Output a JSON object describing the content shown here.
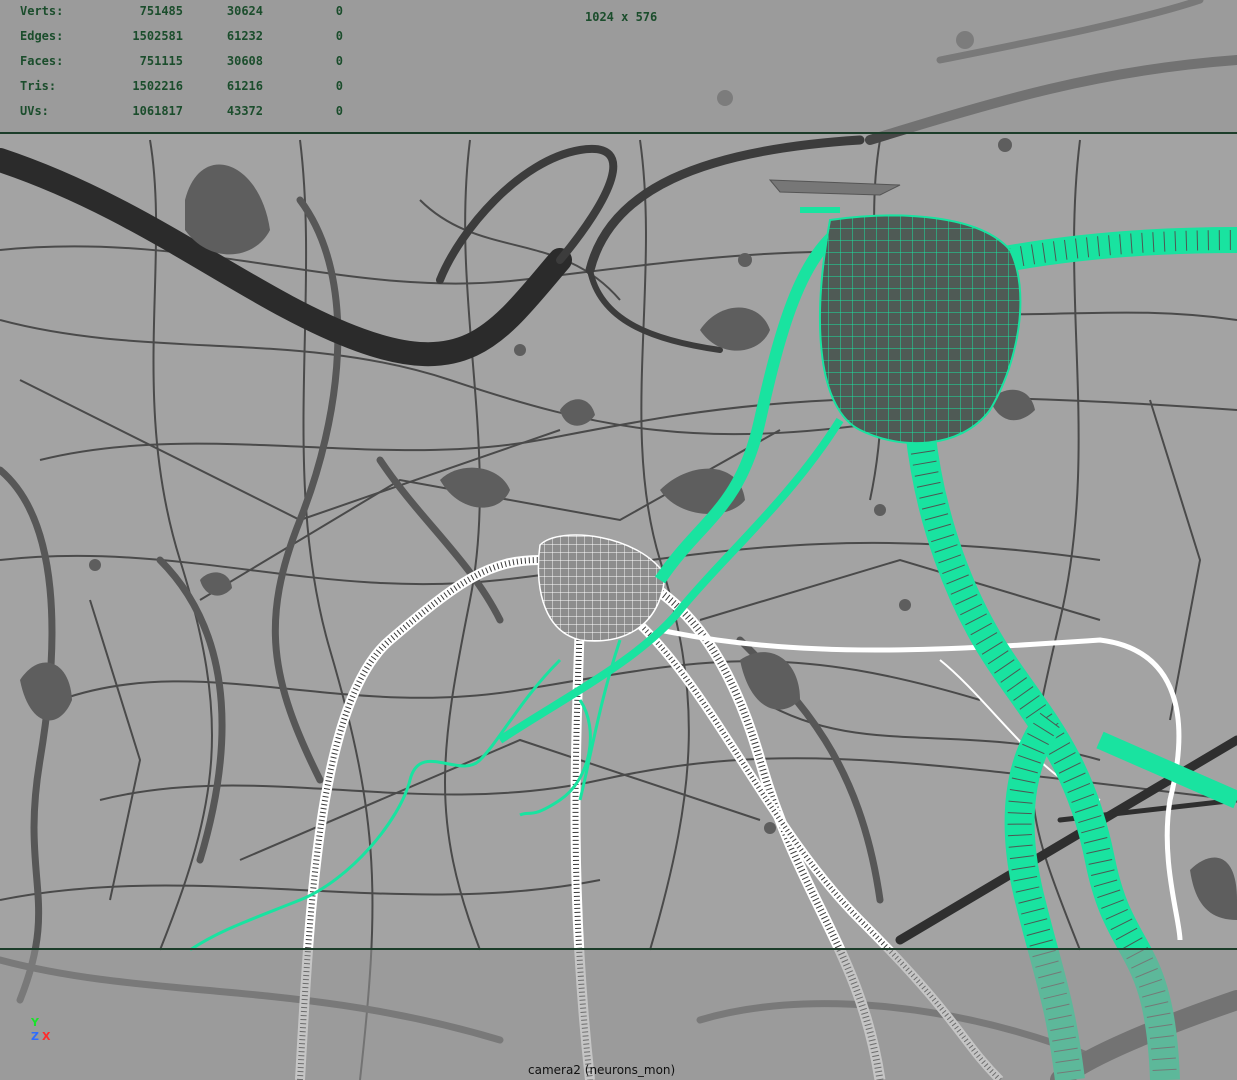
{
  "hud": {
    "rows": [
      {
        "label": "Verts:",
        "total": "751485",
        "selected": "30624",
        "component": "0"
      },
      {
        "label": "Edges:",
        "total": "1502581",
        "selected": "61232",
        "component": "0"
      },
      {
        "label": "Faces:",
        "total": "751115",
        "selected": "30608",
        "component": "0"
      },
      {
        "label": "Tris:",
        "total": "1502216",
        "selected": "61216",
        "component": "0"
      },
      {
        "label": "UVs:",
        "total": "1061817",
        "selected": "43372",
        "component": "0"
      }
    ]
  },
  "resolution_gate": "1024 x 576",
  "camera_label": "camera2 (neurons_mon)",
  "axis": {
    "y": "Y",
    "z": "Z",
    "x": "X"
  },
  "colors": {
    "viewport_bg": "#a3a3a3",
    "neuron_fill": "#5e5e5e",
    "selected_wire": "#19e3a0",
    "white_wire": "#ffffff",
    "hud_text": "#1b4d2c"
  }
}
